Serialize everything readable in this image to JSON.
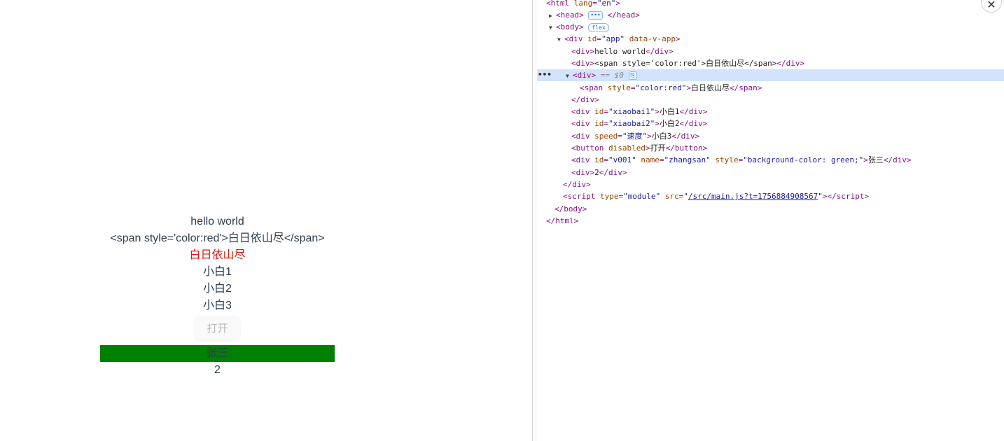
{
  "preview": {
    "hello": "hello world",
    "raw_span": "<span style='color:red'>白日依山尽</span>",
    "red_text": "白日依山尽",
    "items": [
      "小白1",
      "小白2",
      "小白3"
    ],
    "button": "打开",
    "green_text": "张三",
    "number": "2"
  },
  "colors": {
    "red": "#e8130d",
    "green": "#008000",
    "selection": "#d3e3fd"
  },
  "devtools": {
    "badge_flex": "flex",
    "selected_ref": "== $0",
    "script_src": "/src/main.js?t=1756884908567"
  }
}
